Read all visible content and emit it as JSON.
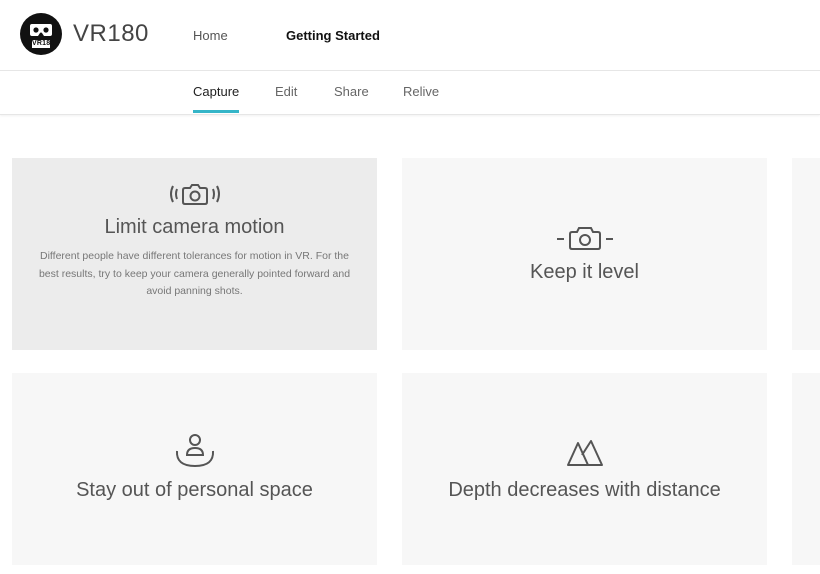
{
  "header": {
    "logo_text": "VR180",
    "brand": "VR180",
    "nav": {
      "home": "Home",
      "getting_started": "Getting Started"
    }
  },
  "tabs": [
    "Capture",
    "Edit",
    "Share",
    "Relive"
  ],
  "active_tab": "Capture",
  "accent_color": "#35b5c8",
  "cards": [
    {
      "icon": "camera-motion-icon",
      "title": "Limit camera motion",
      "description": "Different people have different tolerances for motion in VR. For the best results, try to keep your camera generally pointed forward and avoid panning shots."
    },
    {
      "icon": "camera-level-icon",
      "title": "Keep it level"
    },
    {
      "icon": "personal-space-icon",
      "title": "Stay out of personal space"
    },
    {
      "icon": "mountains-icon",
      "title": "Depth decreases with distance"
    }
  ]
}
